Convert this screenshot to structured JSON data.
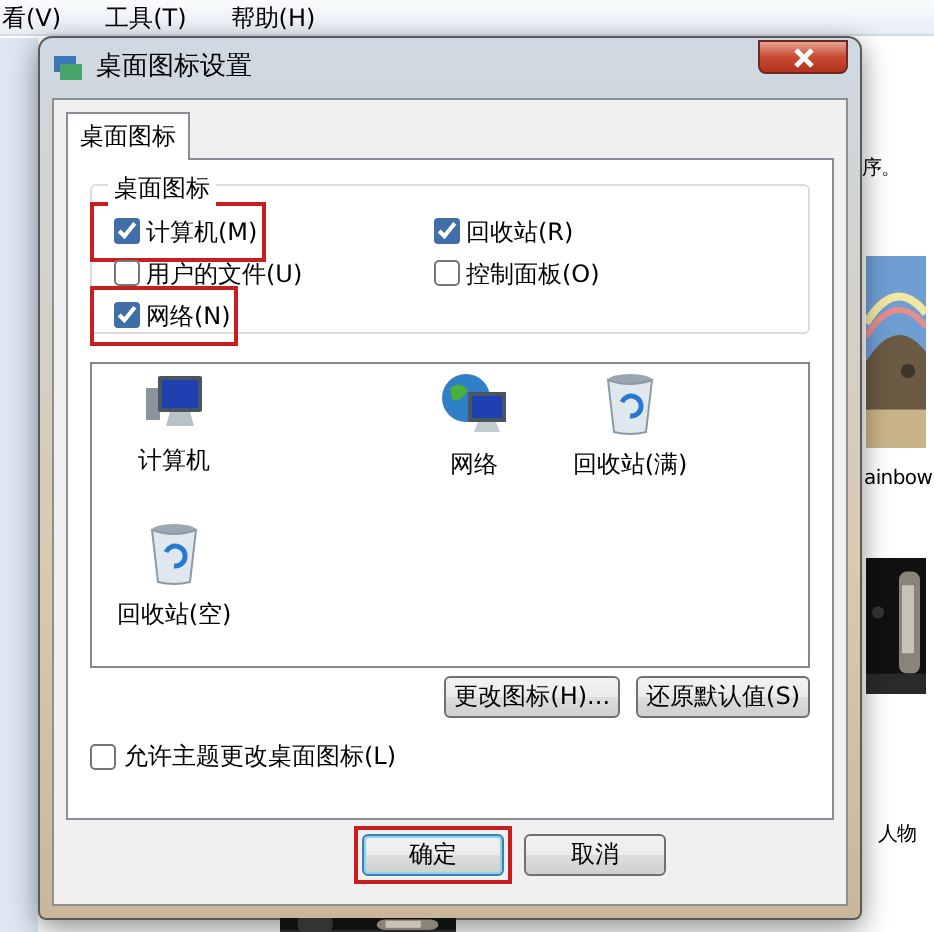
{
  "background": {
    "menu": [
      "看(V)",
      "工具(T)",
      "帮助(H)"
    ],
    "side_texts": [
      "序。",
      "ainbow",
      "人物"
    ]
  },
  "dialog": {
    "title": "桌面图标设置",
    "tabs": [
      {
        "label": "桌面图标",
        "selected": true
      }
    ],
    "group": {
      "title": "桌面图标",
      "options": [
        {
          "label": "计算机(M)",
          "checked": true,
          "highlighted": true
        },
        {
          "label": "回收站(R)",
          "checked": true,
          "highlighted": false
        },
        {
          "label": "用户的文件(U)",
          "checked": false,
          "highlighted": false
        },
        {
          "label": "控制面板(O)",
          "checked": false,
          "highlighted": false
        },
        {
          "label": "网络(N)",
          "checked": true,
          "highlighted": true
        }
      ]
    },
    "icons": [
      {
        "label": "计算机",
        "kind": "computer"
      },
      {
        "label": "网络",
        "kind": "network"
      },
      {
        "label": "回收站(满)",
        "kind": "bin"
      },
      {
        "label": "回收站(空)",
        "kind": "bin"
      }
    ],
    "buttons": [
      "更改图标(H)...",
      "还原默认值(S)"
    ],
    "allow_themes": {
      "label": "允许主题更改桌面图标(L)",
      "checked": false
    },
    "footer_buttons": [
      {
        "label": "确定",
        "default": true,
        "highlighted": true
      },
      {
        "label": "取消",
        "default": false,
        "highlighted": false
      }
    ]
  }
}
